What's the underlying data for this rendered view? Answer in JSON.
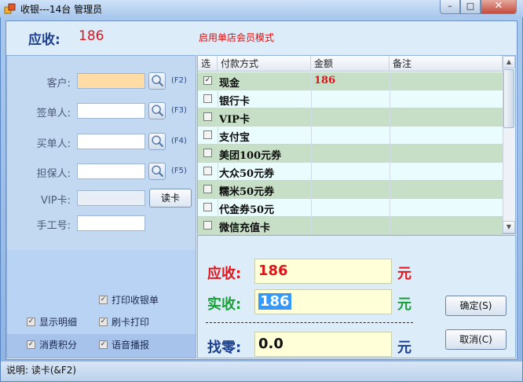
{
  "window": {
    "title": "收银---14台 管理员",
    "min_glyph": "–",
    "max_glyph": "□",
    "close_glyph": "✕"
  },
  "banner": {
    "due_label": "应收:",
    "due_value": "186",
    "member_mode": "启用单店会员模式"
  },
  "form": {
    "customer_label": "客户:",
    "customer_key": "(F2)",
    "signer_label": "签单人:",
    "signer_key": "(F3)",
    "buyer_label": "买单人:",
    "buyer_key": "(F4)",
    "guarantor_label": "担保人:",
    "guarantor_key": "(F5)",
    "vip_label": "VIP卡:",
    "read_card_label": "读卡",
    "manual_label": "手工号:"
  },
  "options": {
    "print_receipt": {
      "label": "打印收银单",
      "checked": true
    },
    "show_detail": {
      "label": "显示明细",
      "checked": true
    },
    "card_print": {
      "label": "刷卡打印",
      "checked": true
    },
    "consume_points": {
      "label": "消费积分",
      "checked": true
    },
    "voice_broadcast": {
      "label": "语音播报",
      "checked": true
    }
  },
  "grid": {
    "headers": [
      "选",
      "付款方式",
      "金额",
      "备注"
    ],
    "rows": [
      {
        "name": "现金",
        "amount": "186",
        "checked": true
      },
      {
        "name": "银行卡",
        "amount": "",
        "checked": false
      },
      {
        "name": "VIP卡",
        "amount": "",
        "checked": false
      },
      {
        "name": "支付宝",
        "amount": "",
        "checked": false
      },
      {
        "name": "美团100元券",
        "amount": "",
        "checked": false
      },
      {
        "name": "大众50元券",
        "amount": "",
        "checked": false
      },
      {
        "name": "糯米50元券",
        "amount": "",
        "checked": false
      },
      {
        "name": "代金券50元",
        "amount": "",
        "checked": false
      },
      {
        "name": "微信充值卡",
        "amount": "",
        "checked": false
      }
    ]
  },
  "summary": {
    "due_label": "应收:",
    "due_value": "186",
    "paid_label": "实收:",
    "paid_value": "186",
    "change_label": "找零:",
    "change_value": "0.0",
    "unit": "元"
  },
  "buttons": {
    "confirm": "确定(S)",
    "cancel": "取消(C)"
  },
  "status": {
    "text": "说明:  读卡(&F2)"
  },
  "colors": {
    "due_red": "#e0141a",
    "paid_green": "#1a9e3a",
    "change_blue": "#1c3f8f"
  }
}
